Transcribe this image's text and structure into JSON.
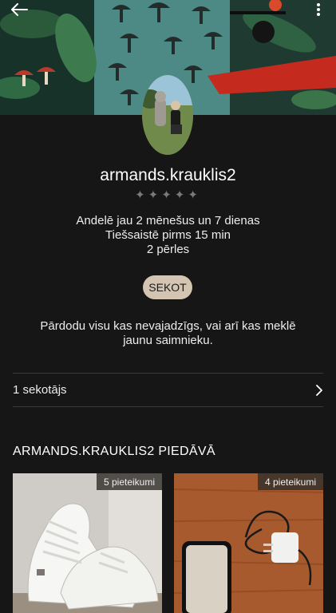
{
  "profile": {
    "username": "armands.krauklis2",
    "rating_stars": "✦✦✦✦✦",
    "member_since": "Andelē jau 2 mēnešus un 7 dienas",
    "last_online": "Tiešsaistē pirms 15 min",
    "pearls": "2 pērles",
    "follow_label": "SEKOT",
    "bio": "Pārdodu visu kas nevajadzīgs, vai arī kas meklē jaunu saimnieku."
  },
  "followers": {
    "label": "1 sekotājs"
  },
  "listings": {
    "title": "ARMANDS.KRAUKLIS2 PIEDĀVĀ",
    "items": [
      {
        "badge": "5 pieteikumi",
        "image": "white-sneakers"
      },
      {
        "badge": "4 pieteikumi",
        "image": "phone-and-charger"
      }
    ]
  },
  "icons": {
    "back": "arrow-left-icon",
    "more": "more-vertical-icon",
    "followers_chevron": "chevron-right-icon"
  },
  "colors": {
    "background": "#161616",
    "follow_button": "#d3c5b2"
  }
}
